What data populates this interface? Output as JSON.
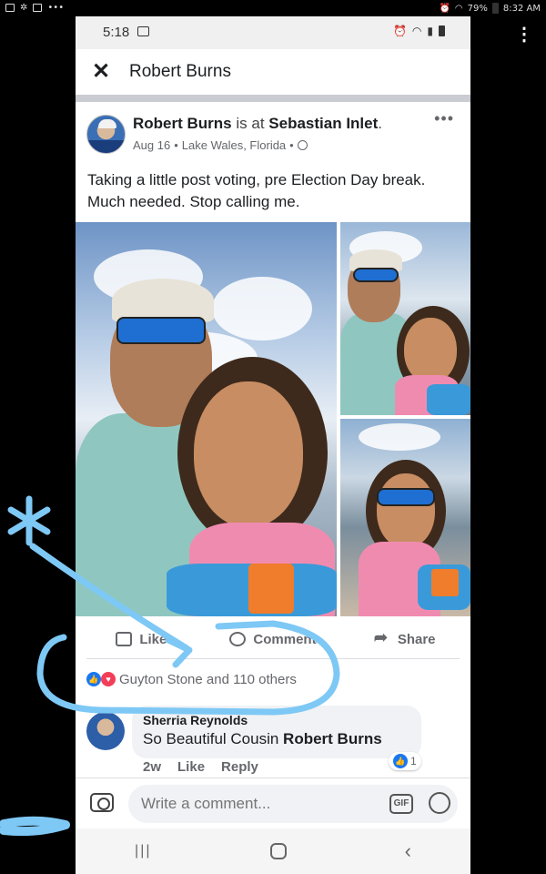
{
  "device_status": {
    "battery": "79%",
    "time": "8:32 AM"
  },
  "phone_status": {
    "time": "5:18"
  },
  "header": {
    "title": "Robert Burns"
  },
  "post": {
    "author": "Robert Burns",
    "is_at": "is at",
    "location": "Sebastian Inlet",
    "location_suffix": ".",
    "date": "Aug 16",
    "place": "Lake Wales, Florida",
    "dot1": "•",
    "dot2": "•",
    "text": "Taking a little post voting, pre Election Day break. Much needed. Stop calling me."
  },
  "actions": {
    "like": "Like",
    "comment": "Comment",
    "share": "Share"
  },
  "reactions": {
    "summary": "Guyton Stone and 110 others"
  },
  "comment": {
    "author": "Sherria Reynolds",
    "text": "So Beautiful  Cousin ",
    "mention": "Robert Burns",
    "age": "2w",
    "like": "Like",
    "reply": "Reply",
    "reaction_count": "1"
  },
  "composer": {
    "placeholder": "Write a comment...",
    "gif": "GIF"
  },
  "colors": {
    "facebook_blue": "#1877f2",
    "marker_blue": "#7ec8f5"
  }
}
